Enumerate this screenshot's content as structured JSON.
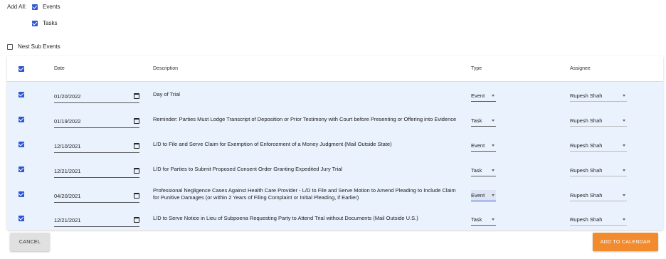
{
  "add_all": {
    "label": "Add All:",
    "options": [
      {
        "label": "Events",
        "checked": true
      },
      {
        "label": "Tasks",
        "checked": true
      }
    ]
  },
  "nest_sub_events": {
    "label": "Nest Sub Events",
    "checked": false
  },
  "table": {
    "headers": {
      "date": "Date",
      "description": "Description",
      "type": "Type",
      "assignee": "Assignee"
    },
    "rows": [
      {
        "checked": true,
        "date": "01/20/2022",
        "description": "Day of Trial",
        "type": "Event",
        "assignee": "Rupesh Shah"
      },
      {
        "checked": true,
        "date": "01/19/2022",
        "description": "Reminder: Parties Must Lodge Transcript of Deposition or Prior Testimony with Court before Presenting or Offering into Evidence",
        "type": "Task",
        "assignee": "Rupesh Shah"
      },
      {
        "checked": true,
        "date": "12/10/2021",
        "description": "L/D to File and Serve Claim for Exemption of Enforcement of a Money Judgment (Mail Outside State)",
        "type": "Event",
        "assignee": "Rupesh Shah"
      },
      {
        "checked": true,
        "date": "12/21/2021",
        "description": "L/D for Parties to Submit Proposed Consent Order Granting Expedited Jury Trial",
        "type": "Task",
        "assignee": "Rupesh Shah"
      },
      {
        "checked": true,
        "date": "04/20/2021",
        "description": "Professional Negligence Cases Against Health Care Provider - L/D to File and Serve Motion to Amend Pleading to Include Claim for Punitive Damages (or within 2 Years of Filing Complaint or Initial Pleading, if Earlier)",
        "type": "Event",
        "assignee": "Rupesh Shah"
      },
      {
        "checked": true,
        "date": "12/21/2021",
        "description": "L/D to Serve Notice in Lieu of Subpoena Requesting Party to Attend Trial without Documents (Mail Outside U.S.)",
        "type": "Task",
        "assignee": "Rupesh Shah"
      }
    ]
  },
  "buttons": {
    "cancel": "CANCEL",
    "add_to_calendar": "ADD TO CALENDAR"
  },
  "colors": {
    "accent": "#2f55d4",
    "row_bg": "#e9f2fd",
    "primary_button": "#f28a2e"
  }
}
